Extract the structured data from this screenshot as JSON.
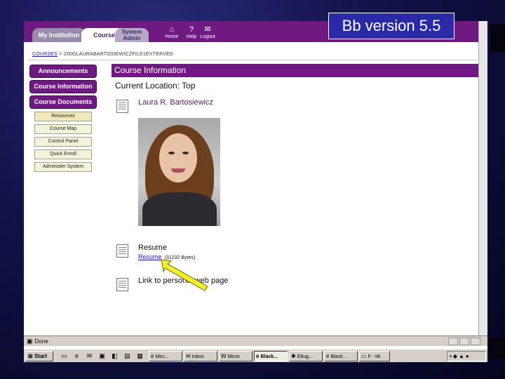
{
  "slide": {
    "caption": "Bb version 5.5"
  },
  "topnav": {
    "tabs": [
      {
        "label": "My Institution"
      },
      {
        "label": "Courses"
      },
      {
        "label": "System Admin"
      }
    ],
    "icons": [
      {
        "label": "Home",
        "icon": "home-icon"
      },
      {
        "label": "Help",
        "icon": "help-icon"
      },
      {
        "label": "Logout",
        "icon": "logout-icon"
      }
    ]
  },
  "breadcrumb": {
    "link": "COURSES",
    "rest": "> 200GLAURABARTOSIEWICZFILE1EXTERVED"
  },
  "leftnav": {
    "buttons": [
      {
        "label": "Announcements"
      },
      {
        "label": "Course Information"
      },
      {
        "label": "Course Documents"
      }
    ],
    "tools": [
      {
        "label": "Resources"
      },
      {
        "label": "Course Map"
      },
      {
        "label": "Control Panel"
      },
      {
        "label": "Quick Enroll"
      },
      {
        "label": "Administer System"
      }
    ]
  },
  "content": {
    "header": "Course Information",
    "location": "Current Location: Top",
    "item_name": "Laura R. Bartosiewicz",
    "resume_title": "Resume",
    "resume_link": "Resume",
    "resume_size": "(31232 Bytes)",
    "webpage_link": "Link to personal web page"
  },
  "statusbar": {
    "text": "Done",
    "icon": "ie-page-icon"
  },
  "taskbar": {
    "start": "Start",
    "buttons": [
      {
        "label": "Micr...",
        "icon": "ie-icon"
      },
      {
        "label": "Inbox",
        "icon": "outlook-icon"
      },
      {
        "label": "Micro",
        "icon": "word-icon"
      },
      {
        "label": "Black...",
        "icon": "ie-icon"
      },
      {
        "label": "Ebug...",
        "icon": "app-icon"
      },
      {
        "label": "Black...",
        "icon": "ie-icon"
      },
      {
        "label": "F - Mi",
        "icon": "folder-icon"
      }
    ]
  }
}
